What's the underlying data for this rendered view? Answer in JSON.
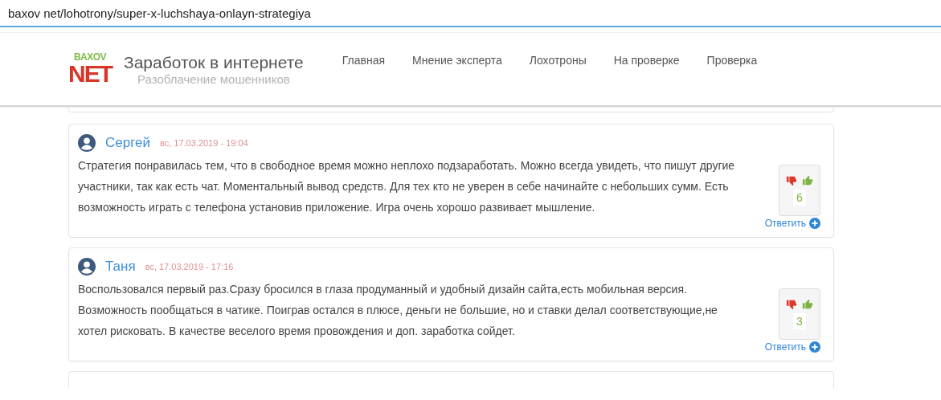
{
  "address_bar": {
    "url": "baxov net/lohotrony/super-x-luchshaya-onlayn-strategiya"
  },
  "header": {
    "logo": {
      "top": "BAXOV",
      "bottom": "NET"
    },
    "title": "Заработок в интернете",
    "subtitle": "Разоблачение мошенников",
    "nav": [
      {
        "label": "Главная"
      },
      {
        "label": "Мнение эксперта"
      },
      {
        "label": "Лохотроны"
      },
      {
        "label": "На проверке"
      },
      {
        "label": "Проверка"
      }
    ]
  },
  "comments": [
    {
      "author": "Сергей",
      "date": "вс, 17.03.2019 - 19:04",
      "text": "Стратегия понравилась тем, что в свободное время можно неплохо подзаработать. Можно всегда увидеть, что пишут другие участники, так как есть чат. Моментальный вывод средств. Для тех кто не уверен в себе начинайте с небольших сумм. Есть возможность играть с телефона установив приложение. Игра очень хорошо развивает мышление.",
      "votes": "6",
      "reply": "Ответить"
    },
    {
      "author": "Таня",
      "date": "вс, 17.03.2019 - 17:16",
      "text": "Воспользовался первый раз.Сразу бросился в глаза продуманный и удобный дизайн сайта,есть мобильная версия. Возможность пообщаться в чатике. Поиграв остался в плюсе, деньги не большие, но и ставки делал соответствующие,не хотел рисковать. В качестве веселого время провождения и доп. заработка сойдет.",
      "votes": "3",
      "reply": "Ответить"
    }
  ]
}
